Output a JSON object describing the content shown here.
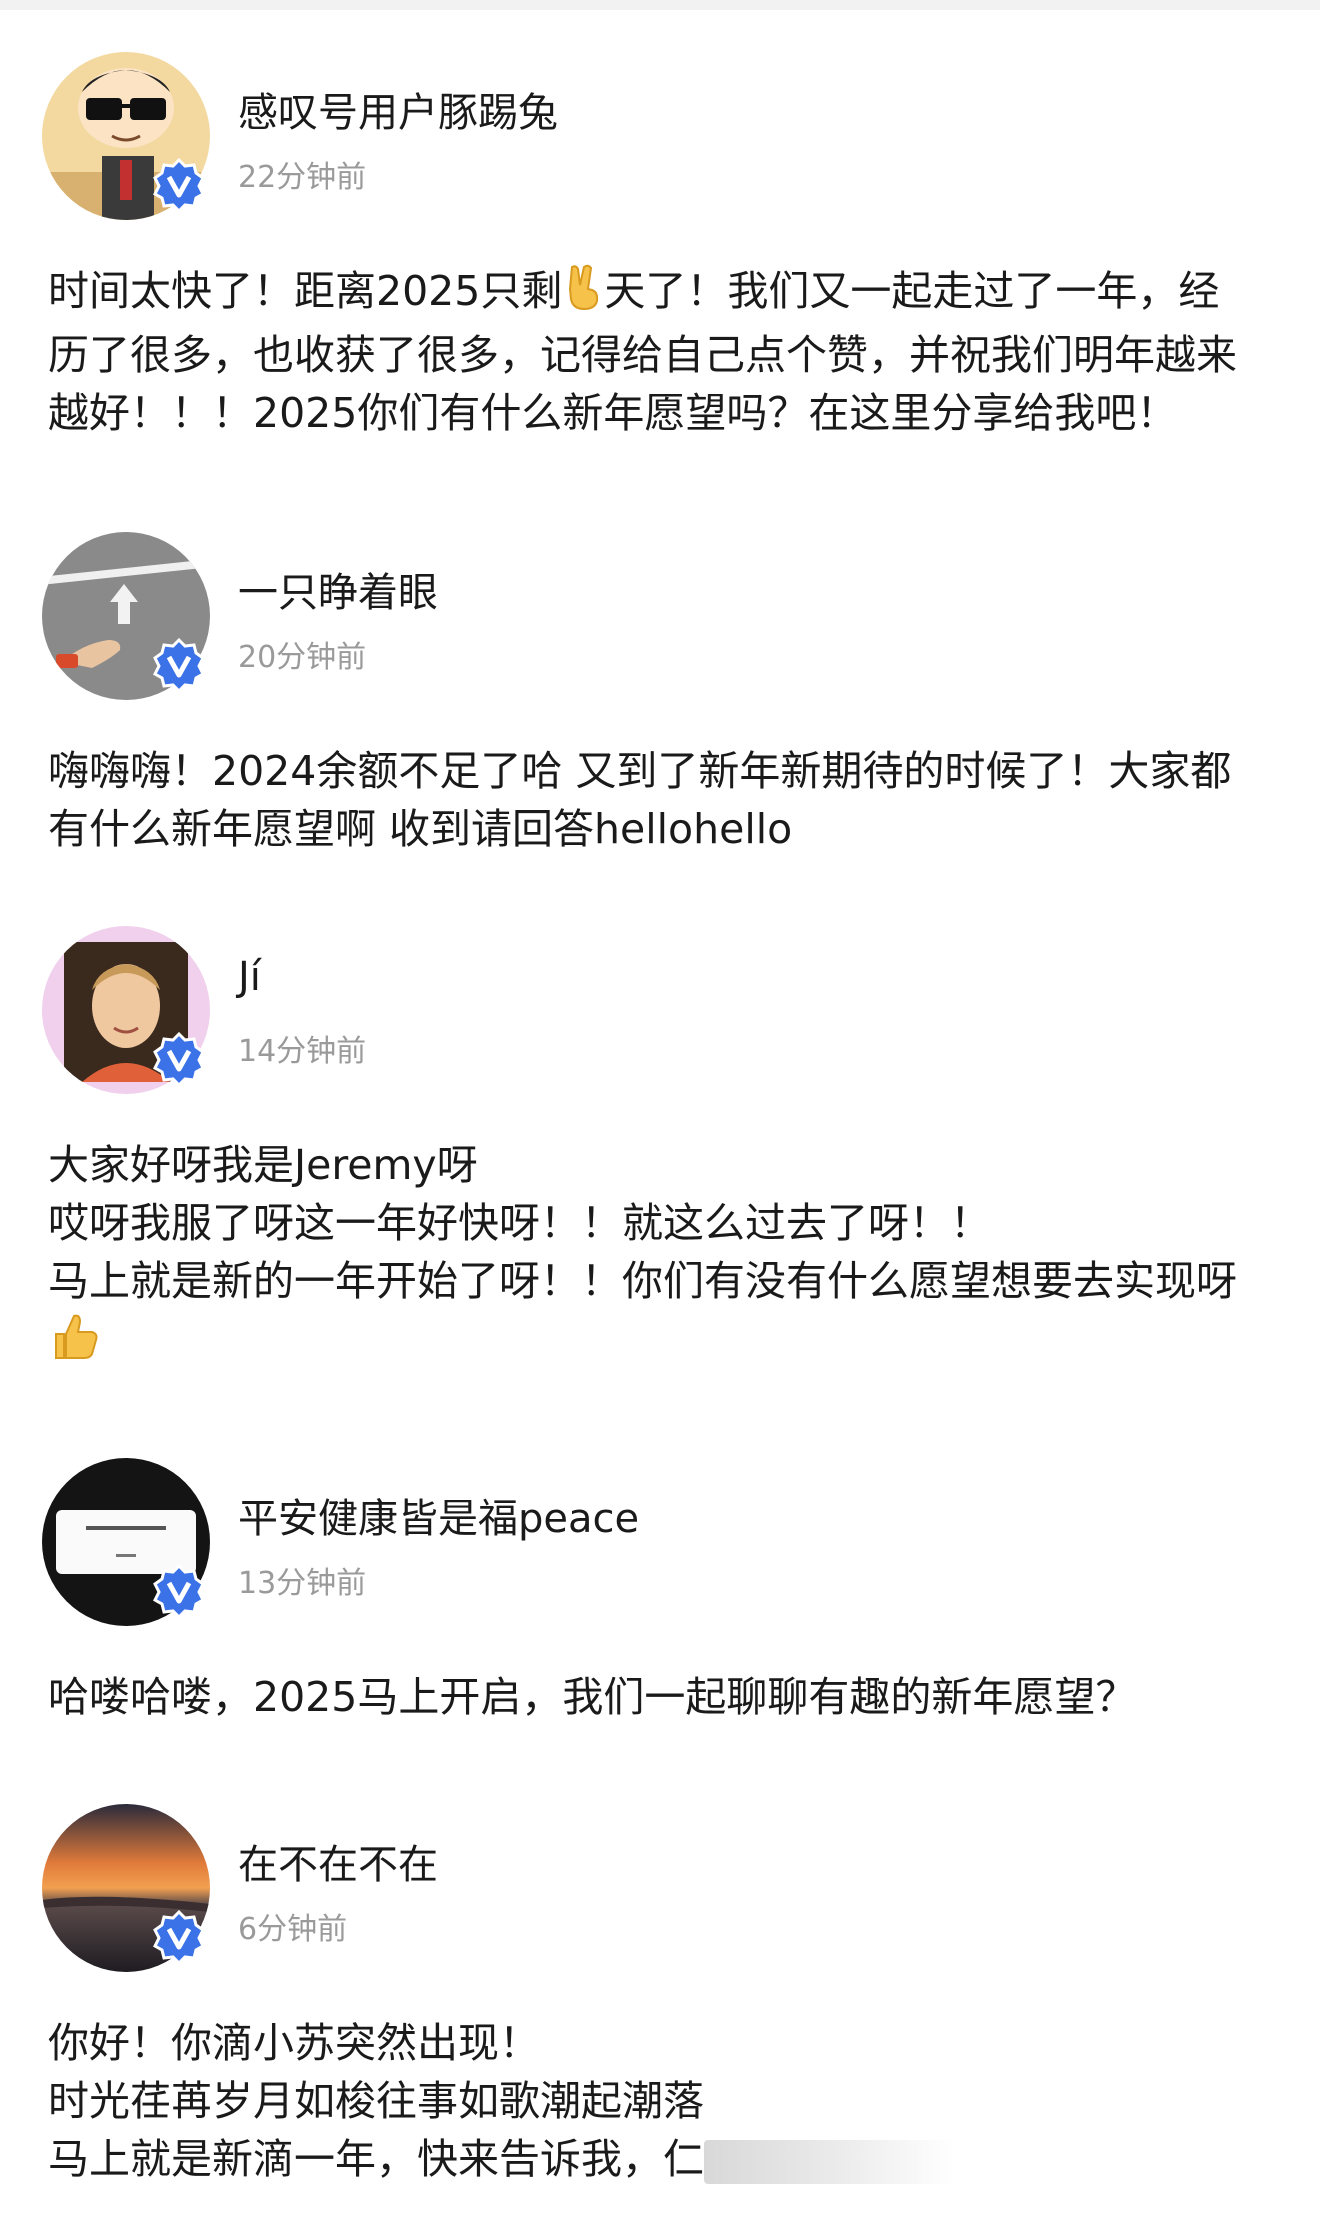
{
  "posts": [
    {
      "username": "感叹号用户豚踢兔",
      "time": "22分钟前",
      "lines": [
        "时间太快了！距离2025只剩",
        "天了！我们又一起走过了一年，经",
        "历了很多，也收获了很多，记得给自己点个赞，并祝我们明年越来",
        "越好！！！2025你们有什么新年愿望吗？在这里分享给我吧！"
      ],
      "avatar_icon": "cartoon-boy-sunglasses-avatar",
      "inline_emoji": "victory-hand-emoji"
    },
    {
      "username": "一只睁着眼",
      "time": "20分钟前",
      "lines": [
        "嗨嗨嗨！2024余额不足了哈 又到了新年新期待的时候了！大家都",
        "有什么新年愿望啊 收到请回答hellohello"
      ],
      "avatar_icon": "road-arrow-hand-avatar"
    },
    {
      "username": "Jí",
      "time": "14分钟前",
      "lines": [
        "大家好呀我是Jeremy呀",
        "哎呀我服了呀这一年好快呀！！就这么过去了呀！！",
        "马上就是新的一年开始了呀！！你们有没有什么愿望想要去实现呀"
      ],
      "avatar_icon": "young-man-photo-avatar",
      "trailing_emoji": "thumbs-up-emoji"
    },
    {
      "username": "平安健康皆是福peace",
      "time": "13分钟前",
      "lines": [
        "哈喽哈喽，2025马上开启，我们一起聊聊有趣的新年愿望？"
      ],
      "avatar_icon": "dialog-screen-avatar"
    },
    {
      "username": "在不在不在",
      "time": "6分钟前",
      "lines": [
        "你好！你滴小苏突然出现！",
        "时光荏苒岁月如梭往事如歌潮起潮落",
        "马上就是新滴一年，快来告诉我，仁"
      ],
      "avatar_icon": "sunset-sky-avatar"
    }
  ],
  "badge_icon": "verified-v-badge-icon",
  "colors": {
    "badge": "#3b72e8",
    "time": "#9a9a9a",
    "text": "#1a1a1a"
  }
}
